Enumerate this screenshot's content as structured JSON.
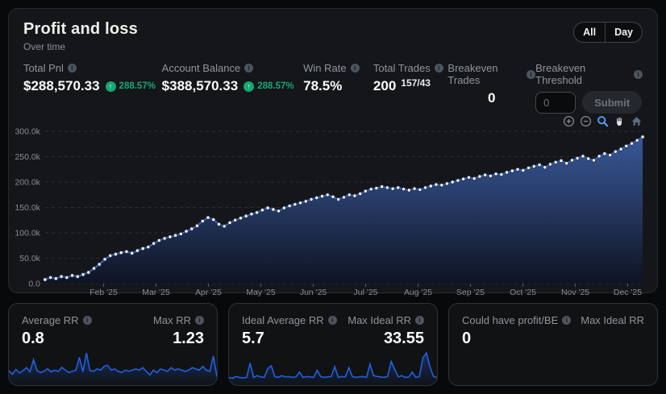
{
  "header": {
    "title": "Profit and loss",
    "subtitle": "Over time",
    "range_all": "All",
    "range_day": "Day"
  },
  "stats": [
    {
      "label": "Total Pnl",
      "value": "$288,570.33",
      "change": "288.57%"
    },
    {
      "label": "Account Balance",
      "value": "$388,570.33",
      "change": "288.57%"
    },
    {
      "label": "Win Rate",
      "value": "78.5%"
    },
    {
      "label": "Total Trades",
      "value": "200",
      "detail": "157/43"
    },
    {
      "label": "Breakeven Trades",
      "value": "0"
    },
    {
      "label": "Breakeven Threshold",
      "input_placeholder": "0",
      "submit_label": "Submit"
    }
  ],
  "toolbar": {
    "icons": [
      "zoom-in",
      "zoom-out",
      "box-zoom",
      "pan",
      "reset-axes-home"
    ],
    "active_icon": "box-zoom",
    "active_color": "#4da3ff"
  },
  "colors": {
    "accent_blue": "#3968cf",
    "spark_blue": "#2160e0",
    "positive_green": "#15a874",
    "card_bg": "#141619",
    "mini_card_bg": "#101214",
    "page_bg": "#08090b"
  },
  "cards": [
    {
      "left_label": "Average RR",
      "left_value": "0.8",
      "right_label": "Max RR",
      "right_value": "1.23"
    },
    {
      "left_label": "Ideal Average RR",
      "left_value": "5.7",
      "right_label": "Max Ideal RR",
      "right_value": "33.55"
    },
    {
      "left_label": "Could have profit/BE",
      "left_value": "0",
      "right_label": "Max Ideal RR",
      "right_value": ""
    }
  ],
  "chart_data": [
    {
      "type": "area",
      "title": "Profit and loss over time (cumulative PnL, USD)",
      "xlabel": "",
      "ylabel": "",
      "x_tick_labels": [
        "Feb '25",
        "Mar '25",
        "Apr '25",
        "May '25",
        "Jun '25",
        "Jul '25",
        "Aug '25",
        "Sep '25",
        "Oct '25",
        "Nov '25",
        "Dec '25"
      ],
      "y_tick_labels": [
        "0.0",
        "50.0k",
        "100.0k",
        "150.0k",
        "200.0k",
        "250.0k",
        "300.0k"
      ],
      "ylim": [
        0,
        300000
      ],
      "grid": "dashed-horizontal",
      "legend": "none",
      "first_tick_frac": 0.098,
      "tick_step_frac": 0.0877,
      "values_thousands": [
        8,
        12,
        10,
        14,
        12,
        16,
        14,
        18,
        22,
        30,
        38,
        48,
        55,
        58,
        61,
        63,
        60,
        65,
        69,
        72,
        79,
        85,
        89,
        92,
        95,
        98,
        103,
        108,
        114,
        123,
        130,
        126,
        117,
        113,
        120,
        125,
        129,
        133,
        137,
        140,
        145,
        149,
        146,
        143,
        149,
        153,
        156,
        159,
        162,
        166,
        169,
        172,
        175,
        171,
        166,
        170,
        175,
        173,
        177,
        182,
        186,
        188,
        191,
        189,
        187,
        189,
        186,
        184,
        187,
        185,
        189,
        192,
        195,
        194,
        197,
        200,
        203,
        206,
        209,
        207,
        211,
        214,
        212,
        216,
        215,
        219,
        222,
        225,
        223,
        228,
        231,
        234,
        229,
        235,
        239,
        242,
        237,
        243,
        247,
        251,
        246,
        243,
        251,
        256,
        253,
        260,
        265,
        271,
        276,
        282,
        289
      ]
    },
    {
      "type": "line",
      "title": "RR per trade sparkline",
      "ymax": 1.23,
      "values": [
        0.5,
        0.35,
        0.55,
        0.4,
        0.5,
        0.62,
        0.45,
        0.95,
        0.5,
        0.42,
        0.48,
        0.58,
        0.45,
        0.52,
        0.47,
        0.63,
        0.52,
        0.42,
        0.47,
        0.52,
        1.05,
        0.45,
        1.23,
        0.5,
        0.47,
        0.57,
        0.52,
        0.67,
        0.72,
        0.52,
        0.57,
        0.47,
        0.42,
        0.52,
        0.47,
        0.52,
        0.57,
        0.52,
        0.62,
        0.47,
        0.32,
        0.52,
        0.42,
        0.57,
        0.52,
        0.47,
        0.62,
        0.52,
        0.57,
        0.52,
        0.47,
        0.52,
        0.62,
        0.57,
        0.52,
        0.67,
        0.52,
        0.47,
        1.1,
        0.25
      ]
    },
    {
      "type": "line",
      "title": "Ideal RR per trade sparkline",
      "ymax": 33.55,
      "values": [
        6,
        5,
        7,
        6,
        5.5,
        6,
        22,
        6,
        8,
        6.5,
        6,
        16,
        19,
        7,
        6,
        8,
        6.5,
        7,
        6,
        6.5,
        12,
        6,
        7,
        6.5,
        6,
        14,
        7,
        6,
        6.5,
        7,
        18,
        6,
        7,
        6.5,
        17,
        7,
        6,
        6.5,
        7,
        6,
        21,
        8,
        7,
        6.5,
        6,
        7,
        24,
        15,
        6.5,
        8,
        6,
        6.5,
        12,
        6,
        7,
        28,
        33.55,
        18,
        7,
        6
      ]
    }
  ]
}
